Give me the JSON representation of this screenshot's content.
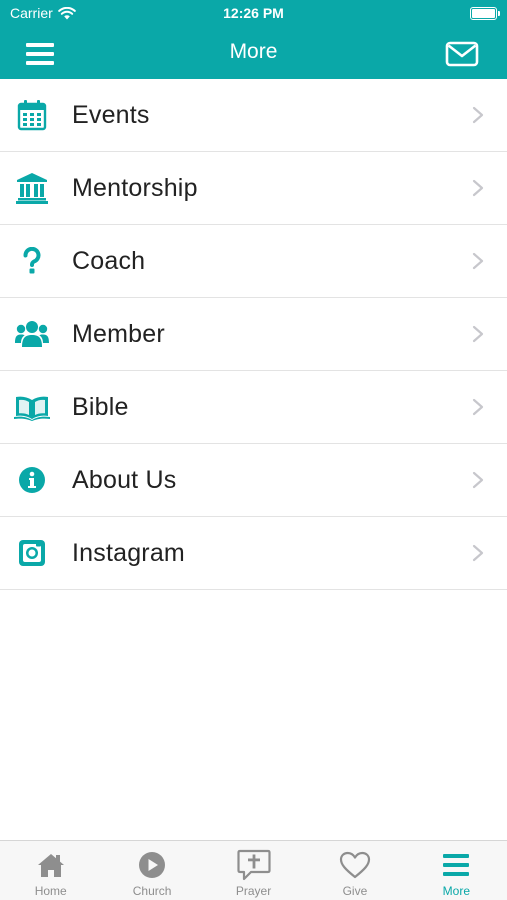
{
  "status_bar": {
    "carrier": "Carrier",
    "time": "12:26 PM",
    "battery_level": 1.0
  },
  "header": {
    "title": "More",
    "menu_icon": "hamburger-icon",
    "mail_icon": "envelope-icon"
  },
  "menu_items": [
    {
      "label": "Events",
      "icon": "calendar-icon"
    },
    {
      "label": "Mentorship",
      "icon": "institution-icon"
    },
    {
      "label": "Coach",
      "icon": "question-icon"
    },
    {
      "label": "Member",
      "icon": "users-icon"
    },
    {
      "label": "Bible",
      "icon": "open-book-icon"
    },
    {
      "label": "About Us",
      "icon": "info-icon"
    },
    {
      "label": "Instagram",
      "icon": "instagram-icon"
    }
  ],
  "tabs": [
    {
      "label": "Home",
      "icon": "home-icon",
      "active": false
    },
    {
      "label": "Church",
      "icon": "play-icon",
      "active": false
    },
    {
      "label": "Prayer",
      "icon": "prayer-icon",
      "active": false
    },
    {
      "label": "Give",
      "icon": "heart-icon",
      "active": false
    },
    {
      "label": "More",
      "icon": "hamburger-icon",
      "active": true
    }
  ],
  "colors": {
    "accent": "#0aa8a8",
    "tab_inactive": "#8e8e8e",
    "chevron": "#c7c7cc",
    "text": "#222222"
  }
}
